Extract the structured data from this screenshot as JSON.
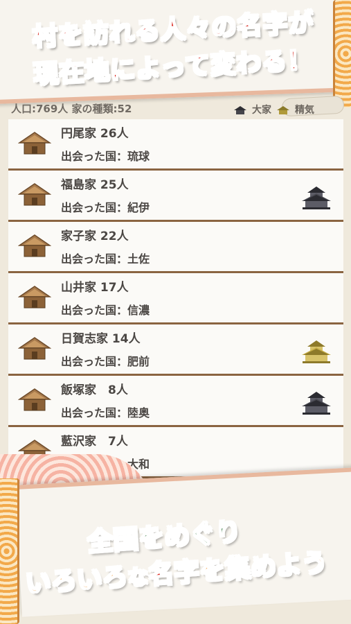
{
  "headline": {
    "line1": "村を訪れる人々の名字が",
    "line2": "現在地によって変わる！"
  },
  "status": {
    "population_label": "人口:",
    "population_value": "769人",
    "types_label": "家の種類:",
    "types_value": "52",
    "legend_a": "大家",
    "legend_b": "精気"
  },
  "families": [
    {
      "name": "円尾家 26人",
      "origin": "出会った国：琉球",
      "castle": ""
    },
    {
      "name": "福島家 25人",
      "origin": "出会った国：紀伊",
      "castle": "black"
    },
    {
      "name": "家子家 22人",
      "origin": "出会った国：土佐",
      "castle": ""
    },
    {
      "name": "山井家 17人",
      "origin": "出会った国：信濃",
      "castle": ""
    },
    {
      "name": "日賀志家 14人",
      "origin": "出会った国：肥前",
      "castle": "gold"
    },
    {
      "name": "飯塚家　8人",
      "origin": "出会った国：陸奥",
      "castle": "black"
    },
    {
      "name": "藍沢家　7人",
      "origin": "出会った国：大和",
      "castle": ""
    }
  ],
  "bottom": {
    "line1": "全国をめぐり",
    "line2_part1": "いろいろ",
    "line2_part2": "な",
    "line2_part3": "名字",
    "line2_part4": "を集めよう"
  },
  "colors": {
    "headline_red": "#d9231b",
    "green": "#1f6b2c",
    "orange": "#f08a1c",
    "row_border": "#8a6441"
  }
}
